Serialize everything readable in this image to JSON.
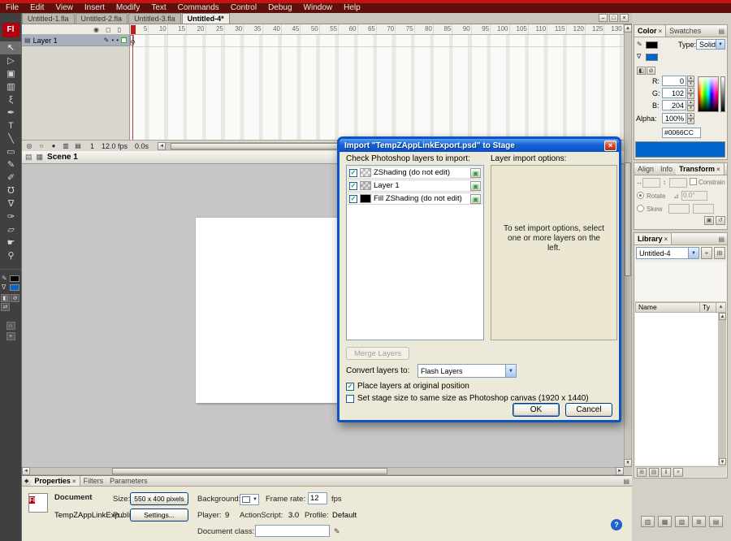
{
  "icons": {
    "close": "×",
    "check": "✓",
    "panel_menu": "▤",
    "dropdown": "▼",
    "pencil": "✎",
    "dot": "•",
    "help": "?",
    "collapse_diamond": "◆",
    "sort": "▲",
    "layer_type": "▣",
    "scroll_left": "◄",
    "scroll_right": "►",
    "scroll_up": "▲",
    "scroll_down": "▼"
  },
  "chrome": {
    "window_buttons": [
      {
        "name": "minimize-window-button",
        "glyph": "–"
      },
      {
        "name": "restore-window-button",
        "glyph": "□"
      },
      {
        "name": "close-window-button",
        "glyph": "×"
      }
    ]
  },
  "menubar": {
    "items": [
      "File",
      "Edit",
      "View",
      "Insert",
      "Modify",
      "Text",
      "Commands",
      "Control",
      "Debug",
      "Window",
      "Help"
    ]
  },
  "doc_tabs": {
    "items": [
      "Untitled-1.fla",
      "Untitled-2.fla",
      "Untitled-3.fla",
      "Untitled-4*"
    ],
    "active_index": 3
  },
  "toolbar": {
    "logo": "Fl",
    "active_tool": "selection-tool",
    "tools": [
      {
        "name": "selection-tool",
        "glyph": "↖"
      },
      {
        "name": "subselection-tool",
        "glyph": "▷"
      },
      {
        "name": "free-transform-tool",
        "glyph": "▣"
      },
      {
        "name": "gradient-transform-tool",
        "glyph": "▥"
      },
      {
        "name": "lasso-tool",
        "glyph": "ξ"
      },
      {
        "name": "pen-tool",
        "glyph": "✒"
      },
      {
        "name": "text-tool",
        "glyph": "T"
      },
      {
        "name": "line-tool",
        "glyph": "╲"
      },
      {
        "name": "rectangle-tool",
        "glyph": "▭"
      },
      {
        "name": "pencil-tool",
        "glyph": "✎"
      },
      {
        "name": "brush-tool",
        "glyph": "✐"
      },
      {
        "name": "ink-bottle-tool",
        "glyph": "℧"
      },
      {
        "name": "paint-bucket-tool",
        "glyph": "∇"
      },
      {
        "name": "eyedropper-tool",
        "glyph": "✑"
      },
      {
        "name": "eraser-tool",
        "glyph": "▱"
      },
      {
        "name": "hand-tool",
        "glyph": "☛"
      },
      {
        "name": "zoom-tool",
        "glyph": "⚲"
      }
    ],
    "stroke_color": "#000000",
    "fill_color": "#0066CC",
    "mini_buttons": [
      {
        "name": "black-white-colors-icon",
        "glyph": "◧"
      },
      {
        "name": "no-color-icon",
        "glyph": "⊘"
      },
      {
        "name": "swap-colors-icon",
        "glyph": "⇄"
      }
    ],
    "options": [
      {
        "name": "snap-to-objects-icon",
        "glyph": "∩"
      },
      {
        "name": "tool-option-icon",
        "glyph": "+"
      }
    ]
  },
  "timeline": {
    "layer_name": "Layer 1",
    "header_icons": [
      {
        "name": "show-hide-layers-icon",
        "glyph": "◉"
      },
      {
        "name": "lock-layers-icon",
        "glyph": "◻"
      },
      {
        "name": "outline-layers-icon",
        "glyph": "▯"
      }
    ],
    "ruler": [
      "5",
      "10",
      "15",
      "20",
      "25",
      "30",
      "35",
      "40",
      "45",
      "50",
      "55",
      "60",
      "65",
      "70",
      "75",
      "80",
      "85",
      "90",
      "95",
      "100",
      "105",
      "110",
      "115",
      "120",
      "125",
      "130"
    ],
    "status_icons": [
      {
        "name": "center-frame-icon",
        "glyph": "◎"
      },
      {
        "name": "onion-skin-icon",
        "glyph": "○"
      },
      {
        "name": "onion-skin-outlines-icon",
        "glyph": "●"
      },
      {
        "name": "edit-multiple-frames-icon",
        "glyph": "▥"
      },
      {
        "name": "modify-onion-markers-icon",
        "glyph": "▤"
      }
    ],
    "current_frame": "1",
    "frame_rate": "12.0 fps",
    "elapsed": "0.0s"
  },
  "edit_bar": {
    "scene": "Scene 1",
    "left_icons": [
      {
        "name": "pane-toggle-icon",
        "glyph": "▤"
      },
      {
        "name": "scene-icon",
        "glyph": "▦"
      }
    ],
    "right_icons": [
      {
        "name": "edit-scene-icon",
        "glyph": "▦"
      },
      {
        "name": "edit-symbol-icon",
        "glyph": "⊞"
      }
    ]
  },
  "dialog": {
    "title": "Import \"TempZAppLinkExport.psd\" to Stage",
    "left_label": "Check Photoshop layers to import:",
    "right_label": "Layer import options:",
    "layers": [
      {
        "name": "ZShading (do not edit)",
        "checked": true
      },
      {
        "name": "Layer 1",
        "checked": true
      },
      {
        "name": "Fill ZShading (do not edit)",
        "checked": true
      }
    ],
    "options_hint": "To set import options, select one or more layers on the left.",
    "merge_button": "Merge Layers",
    "convert_label": "Convert layers to:",
    "convert_value": "Flash Layers",
    "checkbox_position": "Place layers at original position",
    "checkbox_stage_size": "Set stage size to same size as Photoshop canvas (1920 x 1440)",
    "ok": "OK",
    "cancel": "Cancel"
  },
  "color_panel": {
    "tab_color": "Color",
    "tab_swatches": "Swatches",
    "type_label": "Type:",
    "type_value": "Solid",
    "r_label": "R:",
    "r_value": "0",
    "g_label": "G:",
    "g_value": "102",
    "b_label": "B:",
    "b_value": "204",
    "alpha_label": "Alpha:",
    "alpha_value": "100%",
    "hex_value": "#0066CC",
    "current_color": "#0066CC"
  },
  "transform_panel": {
    "tab_align": "Align",
    "tab_info": "Info",
    "tab_transform": "Transform",
    "width_value": "",
    "height_value": "",
    "constrain_label": "Constrain",
    "rotate_label": "Rotate",
    "rotate_value": "0.0°",
    "skew_label": "Skew",
    "icons": [
      {
        "name": "duplicate-transform-icon",
        "glyph": "▣"
      },
      {
        "name": "reset-transform-icon",
        "glyph": "↺"
      }
    ]
  },
  "library_panel": {
    "tab": "Library",
    "document": "Untitled-4",
    "header_icons": [
      {
        "name": "pin-library-icon",
        "glyph": "⌖"
      },
      {
        "name": "new-library-window-icon",
        "glyph": "⊞"
      }
    ],
    "name_col": "Name",
    "type_col": "Ty",
    "toolbar_icons": [
      {
        "name": "new-symbol-icon",
        "glyph": "⊞"
      },
      {
        "name": "new-folder-icon",
        "glyph": "▤"
      },
      {
        "name": "item-properties-icon",
        "glyph": "ℹ"
      },
      {
        "name": "delete-item-icon",
        "glyph": "×"
      }
    ]
  },
  "dock": {
    "icons": [
      {
        "name": "dock-panel-icon-1",
        "glyph": "▥"
      },
      {
        "name": "dock-panel-icon-2",
        "glyph": "▦"
      },
      {
        "name": "dock-panel-icon-3",
        "glyph": "▧"
      },
      {
        "name": "dock-panel-icon-4",
        "glyph": "⊞"
      },
      {
        "name": "dock-panel-icon-5",
        "glyph": "▤"
      }
    ]
  },
  "properties_panel": {
    "tab_properties": "Properties",
    "tab_filters": "Filters",
    "tab_parameters": "Parameters",
    "doc_type": "Document",
    "doc_name": "TempZAppLinkExp...",
    "size_label": "Size:",
    "size_value": "550 x 400 pixels",
    "background_label": "Background:",
    "framerate_label": "Frame rate:",
    "framerate_value": "12",
    "fps_label": "fps",
    "publish_label": "Publish:",
    "settings_button": "Settings...",
    "player_label": "Player:",
    "player_value": "9",
    "actionscript_label": "ActionScript:",
    "actionscript_value": "3.0",
    "profile_label": "Profile:",
    "profile_value": "Default",
    "doc_class_label": "Document class:",
    "doc_class_value": ""
  }
}
